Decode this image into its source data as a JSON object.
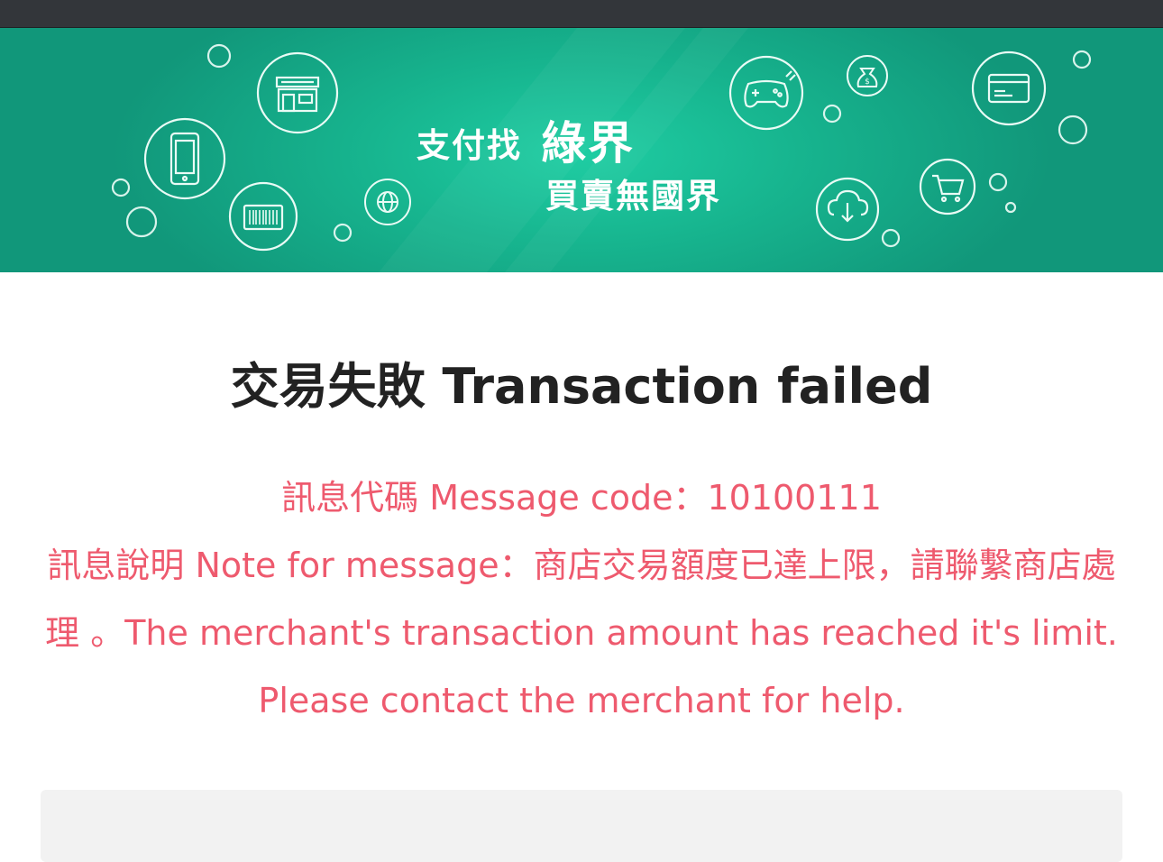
{
  "banner": {
    "slogan_line1": "支付找",
    "brand": "綠界",
    "slogan_line2": "買賣無國界",
    "colors": {
      "primary": "#14a887",
      "light": "#1fcda3",
      "dark": "#11977a"
    },
    "icons": [
      "store-icon",
      "mobile-phone-icon",
      "barcode-icon",
      "globe-icon",
      "gamepad-icon",
      "money-bag-icon",
      "credit-card-icon",
      "shopping-cart-icon",
      "cloud-download-icon"
    ]
  },
  "result": {
    "title": "交易失敗 Transaction failed",
    "code_label": "訊息代碼 Message code：",
    "code_value": "10100111",
    "note_label": "訊息說明 Note for message：",
    "note_text": "商店交易額度已達上限，請聯繫商店處理 。The merchant's transaction amount has reached it's limit. Please contact the merchant for help.",
    "error_color": "#ee5a6e"
  }
}
